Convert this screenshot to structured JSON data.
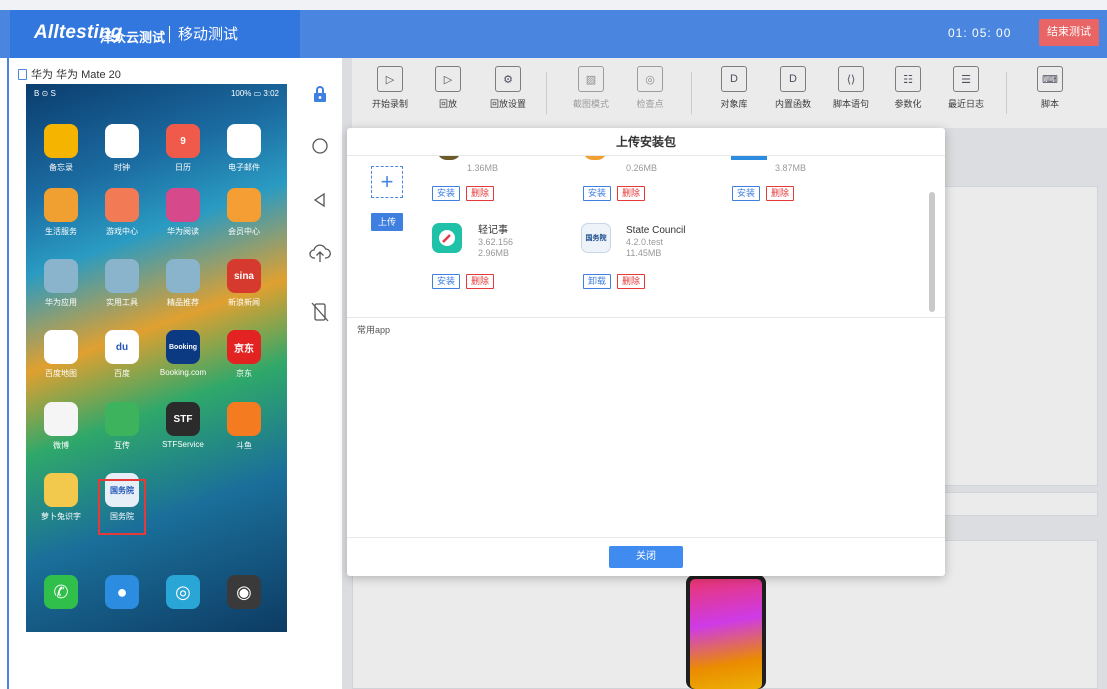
{
  "header": {
    "brand": "Alltesting",
    "brand_sub": "泽众云测试",
    "module": "移动测试",
    "timer": "01: 05: 00",
    "end_button": "结束测试"
  },
  "device": {
    "name": "华为 华为 Mate 20",
    "status_left": "B ⊙ S",
    "status_right": "100% ▭ 3:02",
    "apps": [
      {
        "label": "备忘录",
        "icon": "notes-icon",
        "color": "#f4b400"
      },
      {
        "label": "时钟",
        "icon": "clock-icon",
        "color": "#ffffff"
      },
      {
        "label": "日历",
        "icon": "calendar-icon",
        "color": "#f05a4a"
      },
      {
        "label": "电子邮件",
        "icon": "mail-icon",
        "color": "#ffffff"
      },
      {
        "label": "生活服务",
        "icon": "coffee-icon",
        "color": "#f0a030"
      },
      {
        "label": "游戏中心",
        "icon": "game-icon",
        "color": "#f27a54"
      },
      {
        "label": "华为阅读",
        "icon": "book-icon",
        "color": "#d64a8c"
      },
      {
        "label": "会员中心",
        "icon": "diamond-icon",
        "color": "#f59e33"
      },
      {
        "label": "华为应用",
        "icon": "folder-icon",
        "color": "#8ab3cc"
      },
      {
        "label": "实用工具",
        "icon": "folder-icon",
        "color": "#8ab3cc"
      },
      {
        "label": "精品推荐",
        "icon": "folder-icon",
        "color": "#8ab3cc"
      },
      {
        "label": "新浪新闻",
        "icon": "sina-icon",
        "color": "#d63a2f"
      },
      {
        "label": "百度地图",
        "icon": "map-pin-icon",
        "color": "#ffffff"
      },
      {
        "label": "百度",
        "icon": "baidu-icon",
        "color": "#ffffff"
      },
      {
        "label": "Booking.com",
        "icon": "booking-icon",
        "color": "#0b3a83"
      },
      {
        "label": "京东",
        "icon": "jd-icon",
        "color": "#e32222"
      },
      {
        "label": "微博",
        "icon": "weibo-icon",
        "color": "#f5f5f5"
      },
      {
        "label": "互传",
        "icon": "share-icon",
        "color": "#3db35e"
      },
      {
        "label": "STFService",
        "icon": "stf-icon",
        "color": "#2b2b2b"
      },
      {
        "label": "斗鱼",
        "icon": "douyu-icon",
        "color": "#f47b20"
      },
      {
        "label": "萝卜兔识字",
        "icon": "rabbit-icon",
        "color": "#f2c94c"
      },
      {
        "label": "国务院",
        "icon": "gov-icon",
        "color": "#e6eef7"
      }
    ],
    "app_icon_text": {
      "booking": "Booking",
      "sina": "sina",
      "stf": "STF",
      "gov": "国务院",
      "calendar": "9",
      "baidu": "du",
      "jd": "京东"
    },
    "dock": [
      "phone-icon",
      "message-icon",
      "browser-icon",
      "camera-icon"
    ]
  },
  "toolbar": [
    {
      "label": "开始录制",
      "icon": "record-icon"
    },
    {
      "label": "回放",
      "icon": "play-icon"
    },
    {
      "label": "回放设置",
      "icon": "settings-icon"
    },
    {
      "label": "截图模式",
      "icon": "screenshot-icon",
      "disabled": true
    },
    {
      "label": "检查点",
      "icon": "checkpoint-icon",
      "disabled": true
    },
    {
      "label": "对象库",
      "icon": "object-library-icon"
    },
    {
      "label": "内置函数",
      "icon": "function-icon"
    },
    {
      "label": "脚本语句",
      "icon": "code-icon"
    },
    {
      "label": "参数化",
      "icon": "parameter-icon"
    },
    {
      "label": "最近日志",
      "icon": "log-icon"
    },
    {
      "label": "脚本",
      "icon": "script-icon"
    }
  ],
  "modal": {
    "title": "上传安装包",
    "upload_label": "上传",
    "section_label": "常用app",
    "close_label": "关闭",
    "partial_sizes": [
      "1.36MB",
      "0.26MB",
      "3.87MB"
    ],
    "apps": [
      {
        "name": "轻记事",
        "version": "3.62.156",
        "size": "2.96MB",
        "btn1": "安装",
        "btn2": "删除"
      },
      {
        "name": "State Council",
        "version": "4.2.0.test",
        "size": "11.45MB",
        "btn1": "卸载",
        "btn2": "删除"
      }
    ],
    "row1_buttons": [
      "安装",
      "删除"
    ]
  }
}
